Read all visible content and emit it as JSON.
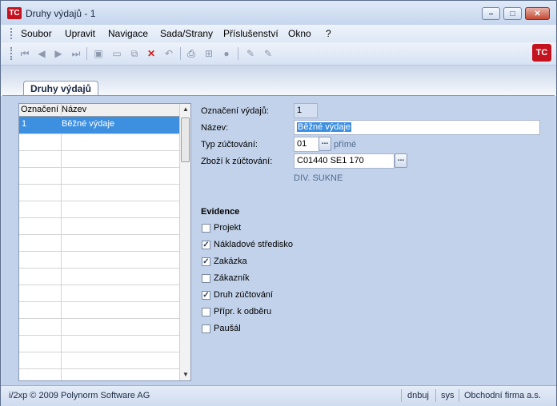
{
  "window": {
    "title": "Druhy výdajů - 1",
    "app_icon": "TC-logo-icon"
  },
  "menu": [
    "Soubor",
    "Upravit",
    "Navigace",
    "Sada/Strany",
    "Příslušenství",
    "Okno",
    "?"
  ],
  "tab": {
    "label": "Druhy výdajů"
  },
  "grid": {
    "columns": [
      "Označení",
      "Název"
    ],
    "rows": [
      {
        "code": "1",
        "name": "Běžné výdaje"
      }
    ]
  },
  "form": {
    "code_label": "Označení výdajů:",
    "code_value": "1",
    "name_label": "Název:",
    "name_value": "Běžné výdaje",
    "accounting_type_label": "Typ zúčtování:",
    "accounting_type_value": "01",
    "accounting_type_hint": "přímé",
    "goods_label": "Zboží k zúčtování:",
    "goods_value": "C01440 SE1 170",
    "goods_hint": "DIV. SUKNE",
    "browse_label": "..."
  },
  "evidence": {
    "title": "Evidence",
    "items": [
      {
        "label": "Projekt",
        "checked": false
      },
      {
        "label": "Nákladové středisko",
        "checked": true
      },
      {
        "label": "Zakázka",
        "checked": true
      },
      {
        "label": "Zákazník",
        "checked": false
      },
      {
        "label": "Druh zúčtování",
        "checked": true
      },
      {
        "label": "Přípr. k odběru",
        "checked": false
      },
      {
        "label": "Paušál",
        "checked": false
      }
    ]
  },
  "status": {
    "copyright": "i/2xp © 2009 Polynorm Software AG",
    "user": "dnbuj",
    "system": "sys",
    "company": "Obchodní firma a.s."
  },
  "colors": {
    "accent": "#3d8fe0",
    "panel": "#c2d2ea",
    "brand": "#c4121e"
  }
}
